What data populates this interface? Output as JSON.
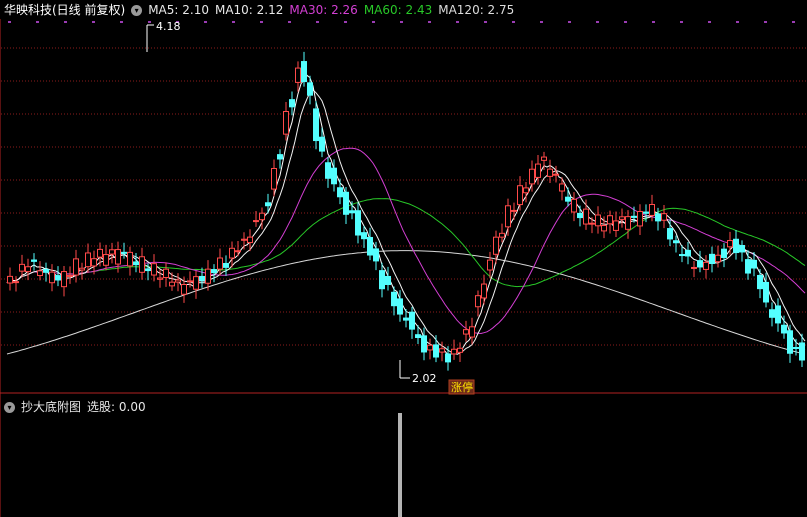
{
  "main_panel": {
    "title": "华映科技(日线 前复权)",
    "ma": [
      {
        "label": "MA5: 2.10",
        "color": "#e8e8e8"
      },
      {
        "label": "MA10: 2.12",
        "color": "#e8e8e8"
      },
      {
        "label": "MA30: 2.26",
        "color": "#d43fd4"
      },
      {
        "label": "MA60: 2.43",
        "color": "#28c828"
      },
      {
        "label": "MA120: 2.75",
        "color": "#dcdcdc"
      }
    ],
    "high_marker": "4.18",
    "low_marker": "2.02",
    "signal_tag": "涨停"
  },
  "sub_panel": {
    "title": "抄大底附图",
    "indicator": "选股: 0.00"
  },
  "colors": {
    "up": "#ff4a4a",
    "down": "#54ffff",
    "grid": "#8b1c1c",
    "divider": "#b22222",
    "signal_bg": "#6e2a1a",
    "signal_fg": "#ffe600"
  }
}
